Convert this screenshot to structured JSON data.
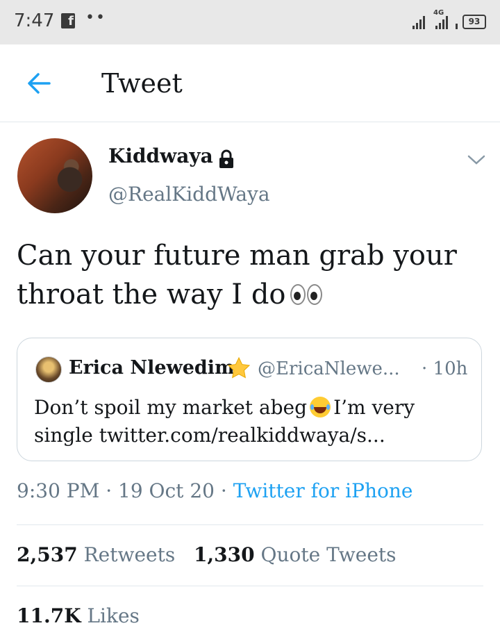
{
  "status_bar": {
    "time": "7:47",
    "network": "4G",
    "battery": "93"
  },
  "header": {
    "title": "Tweet"
  },
  "tweet": {
    "author_name": "Kiddwaya",
    "author_handle": "@RealKiddWaya",
    "text": "Can your future man grab your throat the way I do",
    "emoji": "eyes",
    "timestamp_time": "9:30 PM",
    "separator": "·",
    "timestamp_date": "19 Oct 20",
    "source": "Twitter for iPhone"
  },
  "quoted_tweet": {
    "author_name": "Erica Nlewedim",
    "author_handle": "@EricaNlewe...",
    "time_ago": "· 10h",
    "text_part1": "Don’t spoil my market abeg",
    "text_part2": "I’m very single twitter.com/realkiddwaya/s..."
  },
  "stats": {
    "retweets_count": "2,537",
    "retweets_label": "Retweets",
    "quotes_count": "1,330",
    "quotes_label": "Quote Tweets",
    "likes_count": "11.7K",
    "likes_label": "Likes"
  },
  "colors": {
    "accent": "#1da1f2",
    "secondary_text": "#657786",
    "primary_text": "#14171a",
    "border": "#e1e8ed"
  }
}
